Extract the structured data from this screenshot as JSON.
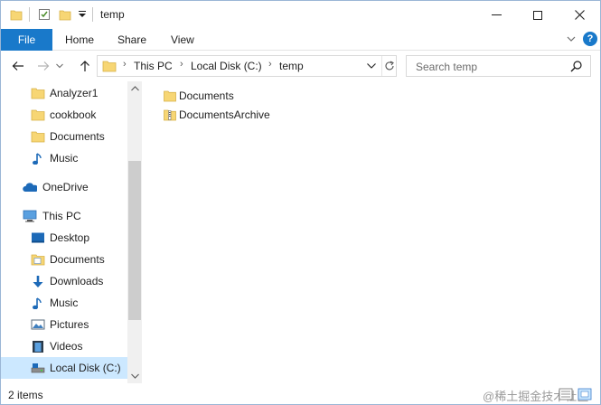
{
  "window": {
    "title": "temp"
  },
  "ribbon": {
    "tabs": [
      "File",
      "Home",
      "Share",
      "View"
    ],
    "help_label": "?"
  },
  "address": {
    "breadcrumbs": [
      "This PC",
      "Local Disk (C:)",
      "temp"
    ]
  },
  "search": {
    "placeholder": "Search temp"
  },
  "navigation": {
    "quick_access_items": [
      {
        "label": "Analyzer1",
        "icon": "folder-icon"
      },
      {
        "label": "cookbook",
        "icon": "folder-icon"
      },
      {
        "label": "Documents",
        "icon": "folder-icon"
      },
      {
        "label": "Music",
        "icon": "music-icon"
      }
    ],
    "onedrive": {
      "label": "OneDrive",
      "icon": "cloud-icon"
    },
    "this_pc": {
      "label": "This PC",
      "icon": "computer-icon"
    },
    "this_pc_items": [
      {
        "label": "Desktop",
        "icon": "desktop-icon"
      },
      {
        "label": "Documents",
        "icon": "documents-icon"
      },
      {
        "label": "Downloads",
        "icon": "download-icon"
      },
      {
        "label": "Music",
        "icon": "music-icon"
      },
      {
        "label": "Pictures",
        "icon": "pictures-icon"
      },
      {
        "label": "Videos",
        "icon": "videos-icon"
      },
      {
        "label": "Local Disk (C:)",
        "icon": "drive-icon",
        "selected": true
      }
    ]
  },
  "files": [
    {
      "name": "Documents",
      "type": "folder"
    },
    {
      "name": "DocumentsArchive",
      "type": "zip-folder"
    }
  ],
  "status": {
    "item_count": "2 items",
    "watermark": "@稀土掘金技术社区"
  },
  "colors": {
    "accent": "#1979ca",
    "folder": "#f7d674",
    "selection": "#cce8ff"
  }
}
